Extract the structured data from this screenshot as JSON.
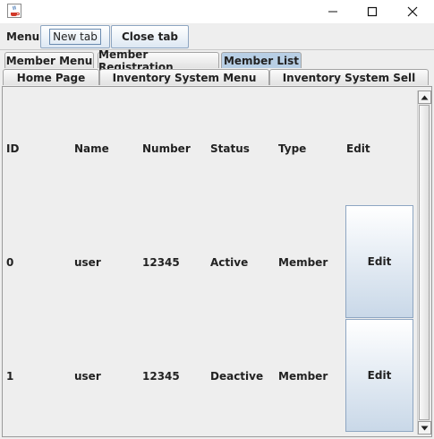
{
  "window": {
    "icon": "java-coffee-icon"
  },
  "menubar": {
    "menu_label": "Menu",
    "new_tab_label": "New tab",
    "close_tab_label": "Close tab"
  },
  "tabs_row1": [
    "Member Menu",
    "Member Registration",
    "Member List"
  ],
  "tabs_row2": [
    "Home Page",
    "Inventory System Menu",
    "Inventory System Sell"
  ],
  "active_tab": "Member List",
  "table": {
    "headers": [
      "ID",
      "Name",
      "Number",
      "Status",
      "Type",
      "Edit"
    ],
    "rows": [
      {
        "id": "0",
        "name": "user",
        "number": "12345",
        "status": "Active",
        "type": "Member",
        "edit_label": "Edit"
      },
      {
        "id": "1",
        "name": "user",
        "number": "12345",
        "status": "Deactive",
        "type": "Member",
        "edit_label": "Edit"
      }
    ]
  },
  "colors": {
    "active_tab": "#b8cfe5",
    "button_border": "#8ea6c2",
    "background": "#eeeeee"
  }
}
